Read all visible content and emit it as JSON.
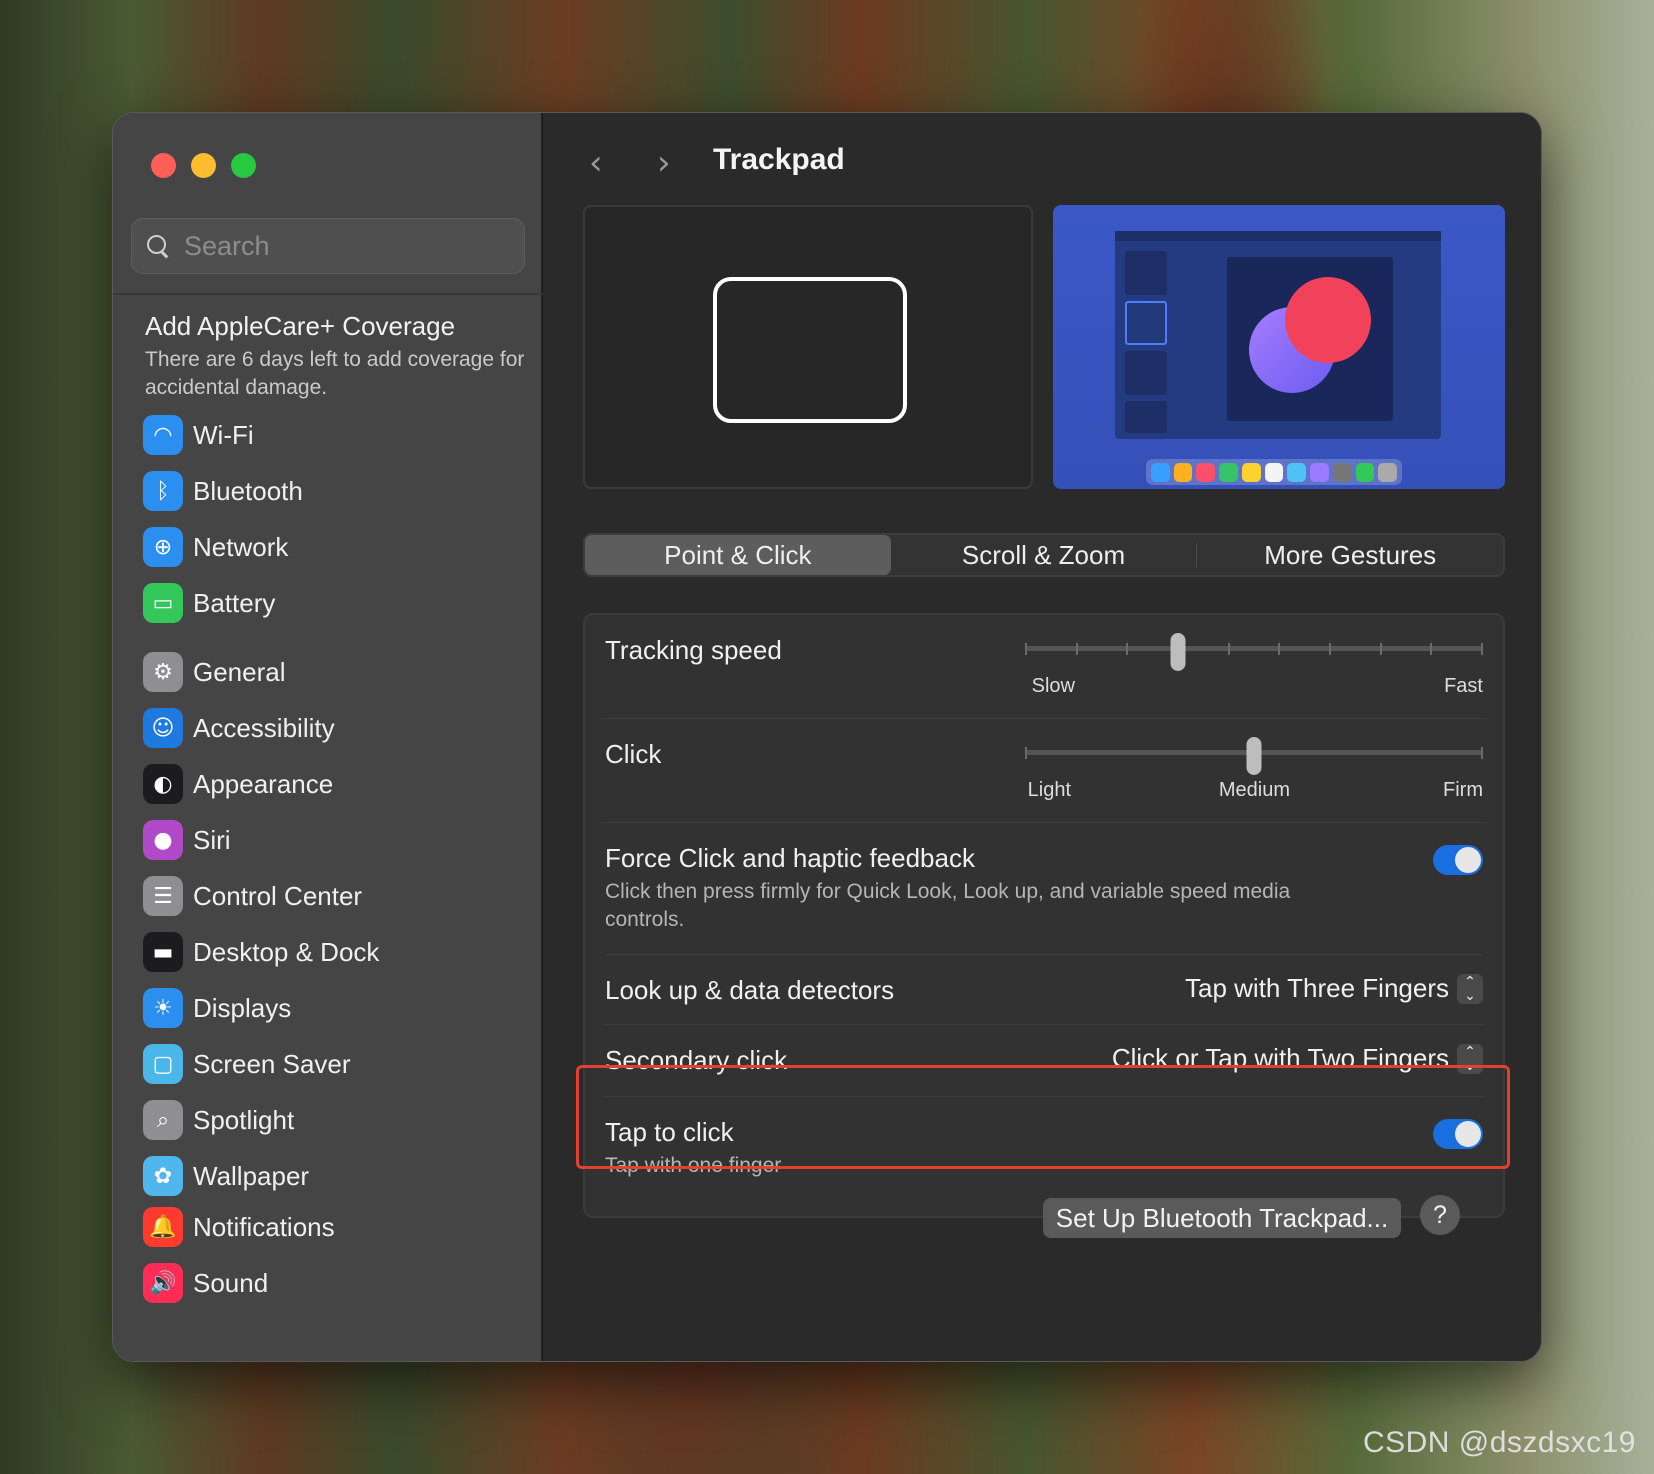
{
  "window": {
    "title": "Trackpad"
  },
  "sidebar": {
    "search_placeholder": "Search",
    "promo": {
      "title": "Add AppleCare+ Coverage",
      "desc": "There are 6 days left to add coverage for accidental damage."
    },
    "groups": [
      [
        {
          "label": "Wi-Fi",
          "icon": "wifi-icon",
          "color": "#2b8ff0",
          "glyph": "◠"
        },
        {
          "label": "Bluetooth",
          "icon": "bluetooth-icon",
          "color": "#2b8ff0",
          "glyph": "ᛒ"
        },
        {
          "label": "Network",
          "icon": "globe-icon",
          "color": "#2b8ff0",
          "glyph": "⊕"
        },
        {
          "label": "Battery",
          "icon": "battery-icon",
          "color": "#34c759",
          "glyph": "▭"
        }
      ],
      [
        {
          "label": "General",
          "icon": "gear-icon",
          "color": "#8e8e93",
          "glyph": "⚙"
        },
        {
          "label": "Accessibility",
          "icon": "accessibility-icon",
          "color": "#1f7ae0",
          "glyph": "☺"
        },
        {
          "label": "Appearance",
          "icon": "appearance-icon",
          "color": "#1c1c1e",
          "glyph": "◐"
        },
        {
          "label": "Siri",
          "icon": "siri-icon",
          "color": "#b04ac8",
          "glyph": "●"
        },
        {
          "label": "Control Center",
          "icon": "control-center-icon",
          "color": "#8e8e93",
          "glyph": "☰"
        },
        {
          "label": "Desktop & Dock",
          "icon": "dock-icon",
          "color": "#1c1c1e",
          "glyph": "▬"
        },
        {
          "label": "Displays",
          "icon": "displays-icon",
          "color": "#2b8ff0",
          "glyph": "☀"
        },
        {
          "label": "Screen Saver",
          "icon": "screen-saver-icon",
          "color": "#4ab7e8",
          "glyph": "▢"
        },
        {
          "label": "Spotlight",
          "icon": "spotlight-icon",
          "color": "#8e8e93",
          "glyph": "⌕"
        },
        {
          "label": "Wallpaper",
          "icon": "wallpaper-icon",
          "color": "#4fb6ee",
          "glyph": "✿"
        }
      ],
      [
        {
          "label": "Notifications",
          "icon": "notifications-icon",
          "color": "#ff3b30",
          "glyph": "🔔"
        },
        {
          "label": "Sound",
          "icon": "sound-icon",
          "color": "#ff2d55",
          "glyph": "🔊"
        }
      ]
    ]
  },
  "toolbar": {
    "back": "‹",
    "forward": "›"
  },
  "tabs": [
    {
      "label": "Point & Click",
      "active": true
    },
    {
      "label": "Scroll & Zoom",
      "active": false
    },
    {
      "label": "More Gestures",
      "active": false
    }
  ],
  "settings": {
    "tracking": {
      "label": "Tracking speed",
      "min": "Slow",
      "max": "Fast",
      "value": 3,
      "steps": 9
    },
    "click": {
      "label": "Click",
      "min": "Light",
      "mid": "Medium",
      "max": "Firm",
      "value": 1,
      "steps": 2
    },
    "force_click": {
      "label": "Force Click and haptic feedback",
      "desc": "Click then press firmly for Quick Look, Look up, and variable speed media controls.",
      "on": true
    },
    "lookup": {
      "label": "Look up & data detectors",
      "value": "Tap with Three Fingers"
    },
    "secondary": {
      "label": "Secondary click",
      "value": "Click or Tap with Two Fingers"
    },
    "tap_to_click": {
      "label": "Tap to click",
      "desc": "Tap with one finger",
      "on": true
    }
  },
  "footer": {
    "setup_button": "Set Up Bluetooth Trackpad...",
    "help": "?"
  },
  "watermark": "CSDN @dszdsxc19",
  "colors": {
    "accent": "#1a6fe0",
    "highlight": "#e2412f"
  }
}
